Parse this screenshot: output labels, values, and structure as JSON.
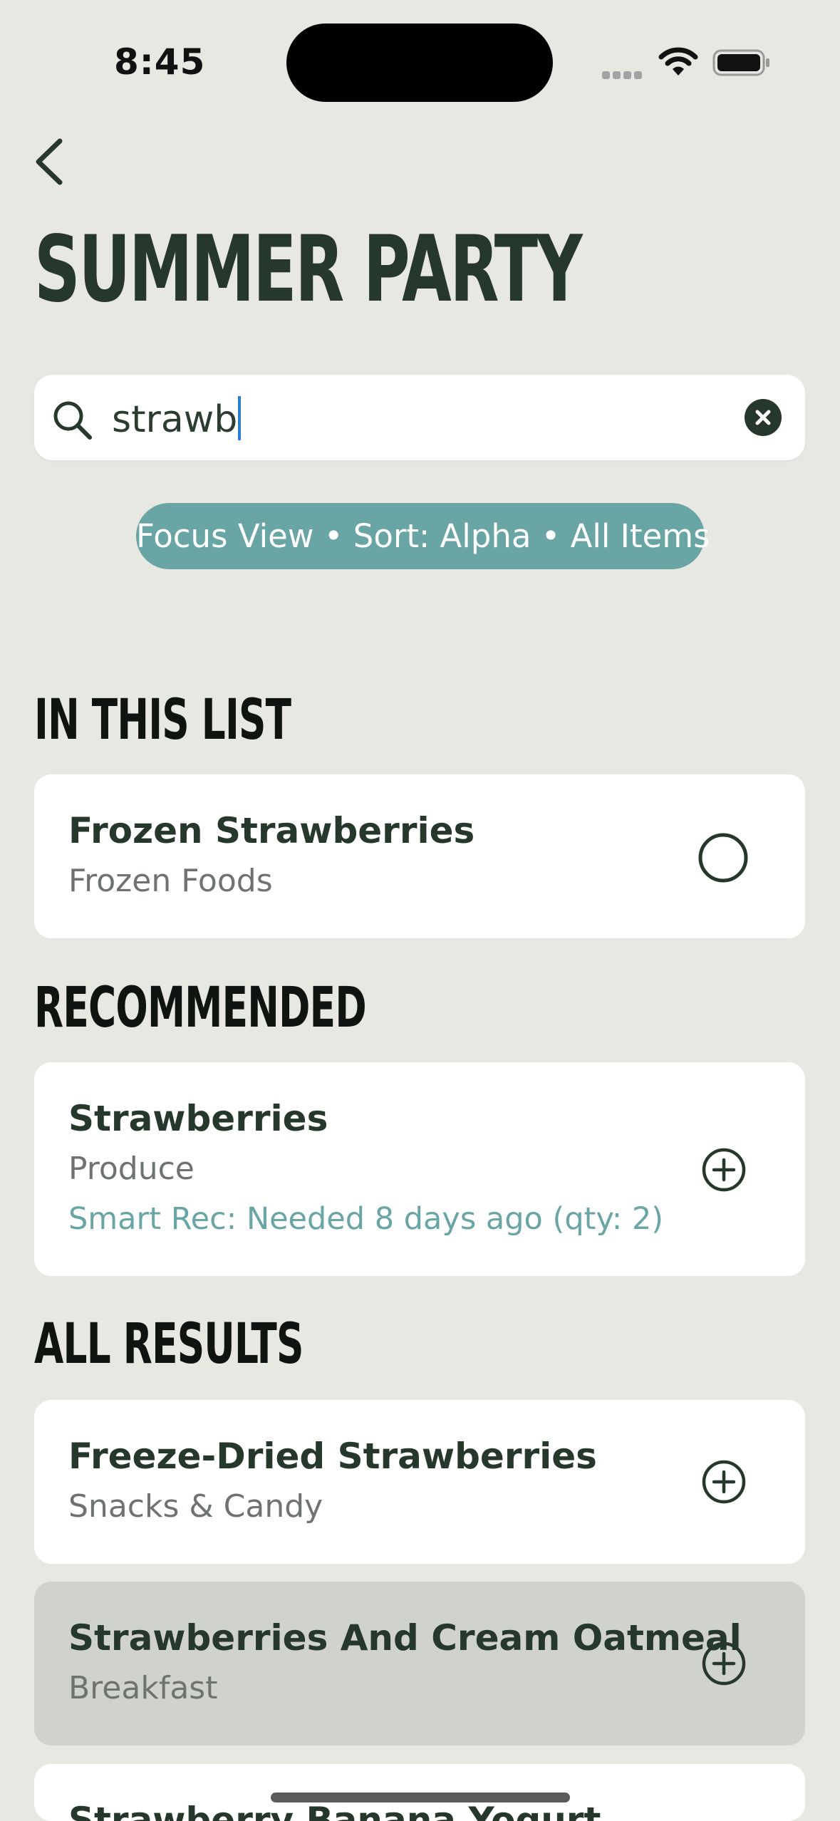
{
  "status": {
    "time": "8:45"
  },
  "header": {
    "title": "SUMMER PARTY"
  },
  "search": {
    "value": "strawb"
  },
  "filter_pill": "Focus View • Sort: Alpha • All Items",
  "sections": {
    "in_list": {
      "title": "IN THIS LIST",
      "items": [
        {
          "name": "Frozen Strawberries",
          "category": "Frozen Foods"
        }
      ]
    },
    "recommended": {
      "title": "RECOMMENDED",
      "items": [
        {
          "name": "Strawberries",
          "category": "Produce",
          "note": "Smart Rec: Needed 8 days ago (qty: 2)"
        }
      ]
    },
    "all_results": {
      "title": "ALL RESULTS",
      "items": [
        {
          "name": "Freeze-Dried Strawberries",
          "category": "Snacks & Candy"
        },
        {
          "name": "Strawberries And Cream Oatmeal",
          "category": "Breakfast"
        },
        {
          "name": "Strawberry Banana Yogurt",
          "category": ""
        }
      ]
    }
  },
  "icons": {
    "back": "chevron-left-icon",
    "search": "search-icon",
    "clear": "clear-icon",
    "uncheck": "circle-icon",
    "add": "add-circle-icon"
  },
  "colors": {
    "accent": "#6aa5a5",
    "text": "#26372b",
    "background": "#e8e8e3",
    "caret": "#2f7bd9"
  }
}
